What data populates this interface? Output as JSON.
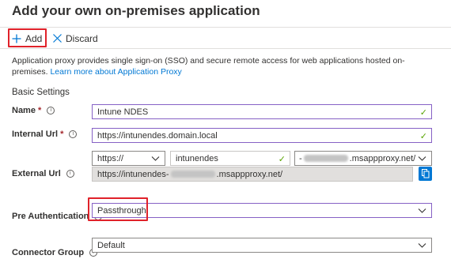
{
  "page": {
    "title": "Add your own on-premises application"
  },
  "toolbar": {
    "add_label": "Add",
    "discard_label": "Discard"
  },
  "intro": {
    "text": "Application proxy provides single sign-on (SSO) and secure remote access for web applications hosted on-premises.",
    "link": "Learn more about Application Proxy"
  },
  "basic_settings": {
    "heading": "Basic Settings",
    "name": {
      "label": "Name",
      "required_mark": "*",
      "value": "Intune NDES"
    },
    "internal_url": {
      "label": "Internal Url",
      "required_mark": "*",
      "value": "https://intunendes.domain.local"
    },
    "external_url": {
      "label": "External Url",
      "protocol": "https://",
      "subdomain": "intunendes",
      "domain_prefix": "-",
      "domain_suffix": ".msappproxy.net/",
      "full_prefix": "https://intunendes-",
      "full_suffix": ".msappproxy.net/"
    },
    "pre_authentication": {
      "label": "Pre Authentication",
      "value": "Passthrough"
    },
    "connector_group": {
      "label": "Connector Group",
      "value": "Default"
    }
  },
  "icons": {
    "info": "i",
    "check": "✓"
  }
}
